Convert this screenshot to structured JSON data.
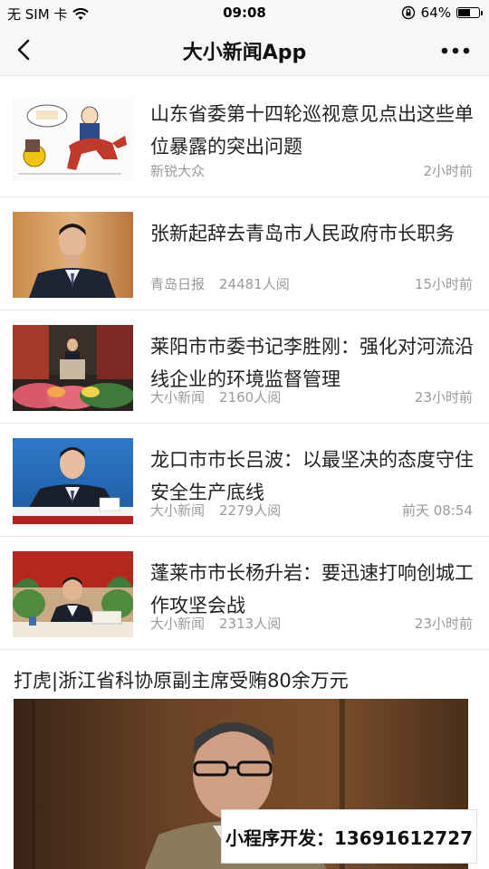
{
  "status_bar": {
    "carrier": "无 SIM 卡",
    "time": "09:08",
    "battery_percent": "64%",
    "battery_level": 0.64
  },
  "nav": {
    "title": "大小新闻App",
    "back_icon": "chevron-left-icon",
    "more_icon": "more-dots-icon"
  },
  "news": [
    {
      "title": "山东省委第十四轮巡视意见点出这些单位暴露的突出问题",
      "source": "新锐大众",
      "reads": "",
      "time": "2小时前"
    },
    {
      "title": "张新起辞去青岛市人民政府市长职务",
      "source": "青岛日报",
      "reads": "24481人阅",
      "time": "15小时前"
    },
    {
      "title": "莱阳市市委书记李胜刚：强化对河流沿线企业的环境监督管理",
      "source": "大小新闻",
      "reads": "2160人阅",
      "time": "23小时前"
    },
    {
      "title": "龙口市市长吕波：以最坚决的态度守住安全生产底线",
      "source": "大小新闻",
      "reads": "2279人阅",
      "time": "前天 08:54"
    },
    {
      "title": "蓬莱市市长杨升岩：要迅速打响创城工作攻坚会战",
      "source": "大小新闻",
      "reads": "2313人阅",
      "time": "23小时前"
    }
  ],
  "feature": {
    "title": "打虎|浙江省科协原副主席受贿80余万元"
  },
  "ad": {
    "text": "小程序开发：13691612727"
  }
}
